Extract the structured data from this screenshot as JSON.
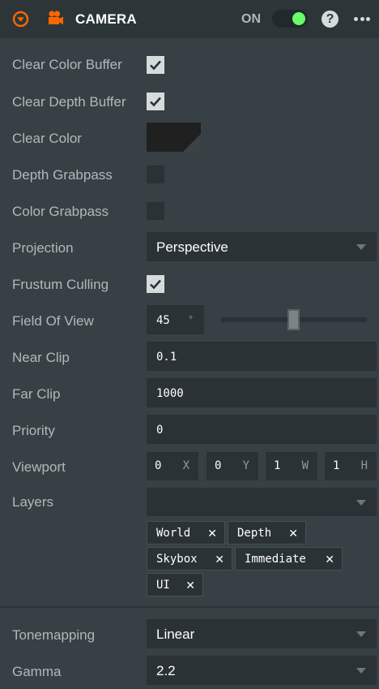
{
  "header": {
    "title": "CAMERA",
    "toggle_label": "ON",
    "toggle_state": "on",
    "help_glyph": "?",
    "icons": [
      "collapse-icon",
      "camera-icon",
      "help-icon",
      "more-icon"
    ],
    "accent_color": "#ff6600",
    "toggle_on_color": "#66ff66"
  },
  "fields": {
    "clear_color_buffer": {
      "label": "Clear Color Buffer",
      "checked": true
    },
    "clear_depth_buffer": {
      "label": "Clear Depth Buffer",
      "checked": true
    },
    "clear_color": {
      "label": "Clear Color",
      "value": "#202020"
    },
    "depth_grabpass": {
      "label": "Depth Grabpass",
      "checked": false
    },
    "color_grabpass": {
      "label": "Color Grabpass",
      "checked": false
    },
    "projection": {
      "label": "Projection",
      "value": "Perspective"
    },
    "frustum_culling": {
      "label": "Frustum Culling",
      "checked": true
    },
    "field_of_view": {
      "label": "Field Of View",
      "value": "45",
      "unit": "°",
      "slider_fraction": 0.5
    },
    "near_clip": {
      "label": "Near Clip",
      "value": "0.1"
    },
    "far_clip": {
      "label": "Far Clip",
      "value": "1000"
    },
    "priority": {
      "label": "Priority",
      "value": "0"
    },
    "viewport": {
      "label": "Viewport",
      "parts": [
        {
          "value": "0",
          "suffix": "X"
        },
        {
          "value": "0",
          "suffix": "Y"
        },
        {
          "value": "1",
          "suffix": "W"
        },
        {
          "value": "1",
          "suffix": "H"
        }
      ]
    },
    "layers": {
      "label": "Layers",
      "tags": [
        {
          "name": "World",
          "remove": "✕"
        },
        {
          "name": "Depth",
          "remove": "✕"
        },
        {
          "name": "Skybox",
          "remove": "✕"
        },
        {
          "name": "Immediate",
          "remove": "✕"
        },
        {
          "name": "UI",
          "remove": "✕"
        }
      ]
    },
    "tonemapping": {
      "label": "Tonemapping",
      "value": "Linear"
    },
    "gamma": {
      "label": "Gamma",
      "value": "2.2"
    }
  }
}
